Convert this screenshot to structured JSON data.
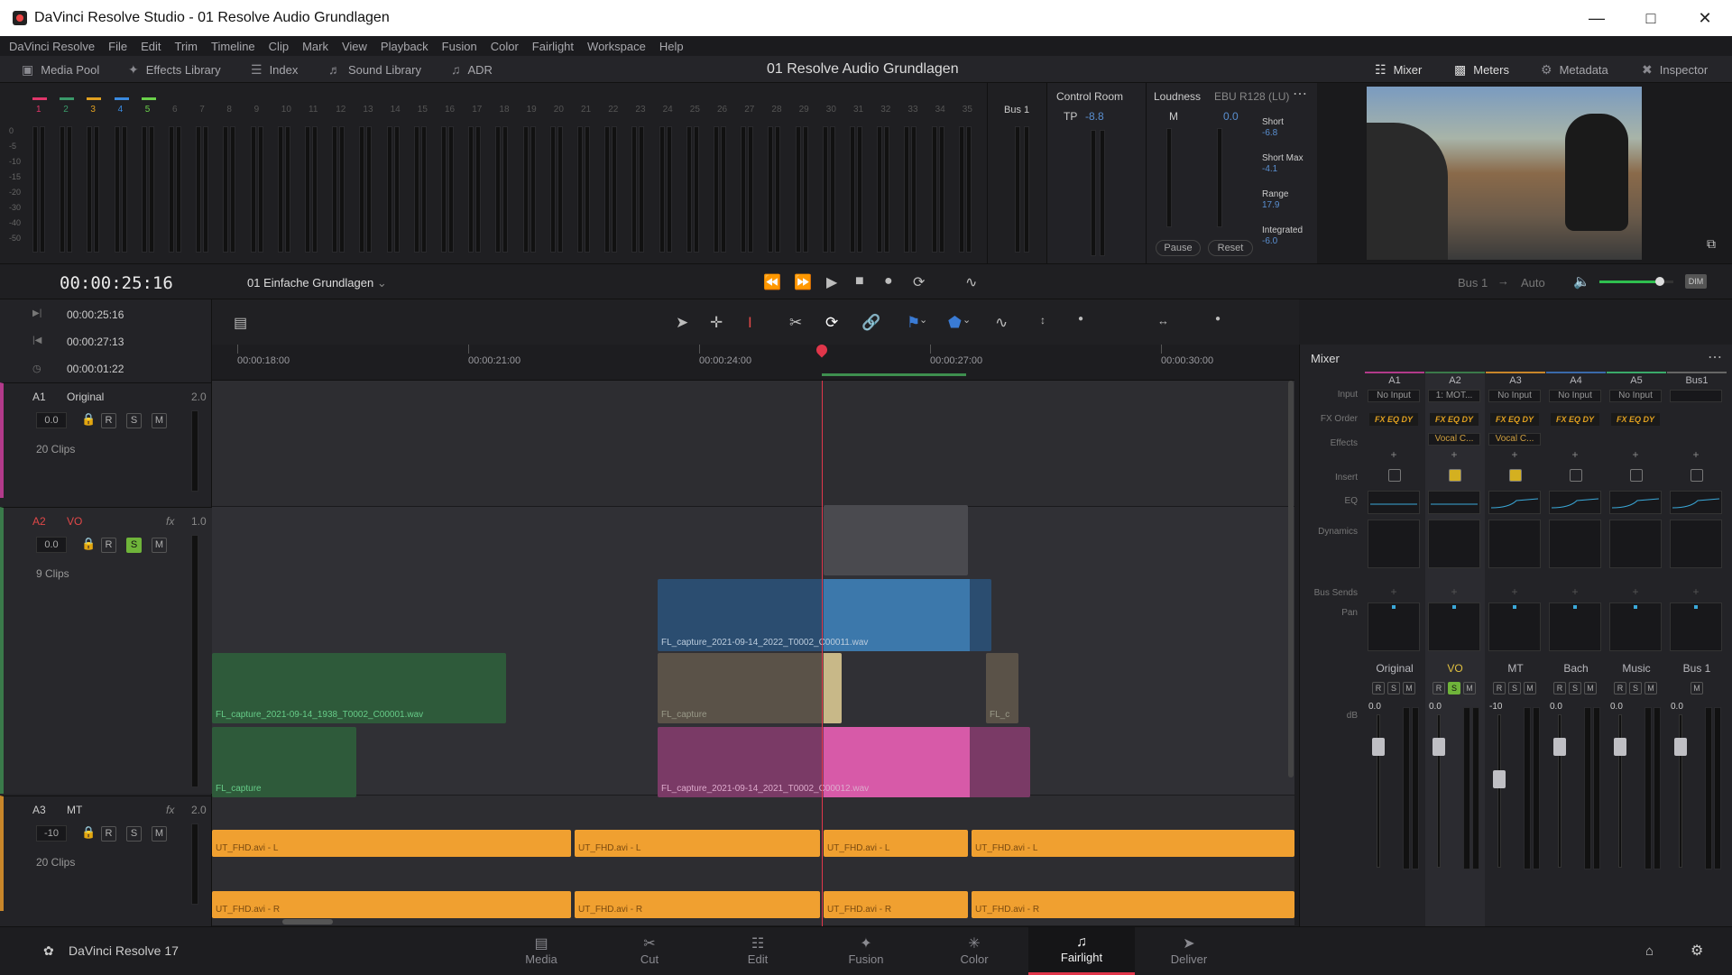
{
  "window": {
    "title": "DaVinci Resolve Studio - 01 Resolve Audio Grundlagen"
  },
  "menu": [
    "DaVinci Resolve",
    "File",
    "Edit",
    "Trim",
    "Timeline",
    "Clip",
    "Mark",
    "View",
    "Playback",
    "Fusion",
    "Color",
    "Fairlight",
    "Workspace",
    "Help"
  ],
  "toolbar": {
    "media_pool": "Media Pool",
    "effects_library": "Effects Library",
    "index": "Index",
    "sound_library": "Sound Library",
    "adr": "ADR",
    "project_title": "01 Resolve Audio Grundlagen",
    "mixer": "Mixer",
    "meters": "Meters",
    "metadata": "Metadata",
    "inspector": "Inspector"
  },
  "meters": {
    "channels": [
      "1",
      "2",
      "3",
      "4",
      "5",
      "6",
      "7",
      "8",
      "9",
      "10",
      "11",
      "12",
      "13",
      "14",
      "15",
      "16",
      "17",
      "18",
      "19",
      "20",
      "21",
      "22",
      "23",
      "24",
      "25",
      "26",
      "27",
      "28",
      "29",
      "30",
      "31",
      "32",
      "33",
      "34",
      "35"
    ],
    "scale": [
      "0",
      "-5",
      "-10",
      "-15",
      "-20",
      "-30",
      "-40",
      "-50"
    ],
    "bus_label": "Bus 1"
  },
  "control_room": {
    "title": "Control Room",
    "tp_label": "TP",
    "tp_value": "-8.8"
  },
  "loudness": {
    "title": "Loudness",
    "standard": "EBU R128 (LU)",
    "m_label": "M",
    "m_value": "0.0",
    "short_label": "Short",
    "short_value": "-6.8",
    "short_max_label": "Short Max",
    "short_max_value": "-4.1",
    "range_label": "Range",
    "range_value": "17.9",
    "integrated_label": "Integrated",
    "integrated_value": "-6.0",
    "pause": "Pause",
    "reset": "Reset"
  },
  "transport": {
    "timecode": "00:00:25:16",
    "timeline_name": "01 Einfache Grundlagen",
    "bus": "Bus 1",
    "auto": "Auto",
    "dim": "DIM",
    "master_volume": 0.82
  },
  "timecodes": {
    "current": "00:00:25:16",
    "out": "00:00:27:13",
    "duration": "00:00:01:22"
  },
  "ruler": [
    "00:00:18:00",
    "00:00:21:00",
    "00:00:24:00",
    "00:00:27:00",
    "00:00:30:00"
  ],
  "tracks": [
    {
      "id": "A1",
      "name": "Original",
      "format": "2.0",
      "volume": "0.0",
      "clips": "20 Clips",
      "fx": ""
    },
    {
      "id": "A2",
      "name": "VO",
      "format": "1.0",
      "volume": "0.0",
      "clips": "9 Clips",
      "fx": "fx"
    },
    {
      "id": "A3",
      "name": "MT",
      "format": "2.0",
      "volume": "-10",
      "clips": "20 Clips",
      "fx": "fx"
    }
  ],
  "clip_labels": {
    "vo_blue": "FL_capture_2021-09-14_2022_T0002_C00011.wav",
    "vo_green": "FL_capture_2021-09-14_1938_T0002_C00001.wav",
    "vo_tan": "FL_capture",
    "vo_tan2": "FL_c",
    "vo_green2": "FL_capture",
    "vo_pink": "FL_capture_2021-09-14_2021_T0002_C00012.wav",
    "mt_l": "UT_FHD.avi - L",
    "mt_r": "UT_FHD.avi - R"
  },
  "mixer": {
    "title": "Mixer",
    "row_labels": {
      "input": "Input",
      "fx_order": "FX Order",
      "effects": "Effects",
      "insert": "Insert",
      "eq": "EQ",
      "dynamics": "Dynamics",
      "bus_sends": "Bus Sends",
      "pan": "Pan",
      "db": "dB"
    },
    "fx_order": "FX EQ DY",
    "channels": [
      {
        "id": "A1",
        "input": "No Input",
        "effect": "",
        "name": "Original",
        "level": "0.0"
      },
      {
        "id": "A2",
        "input": "1: MOT...",
        "effect": "Vocal C...",
        "name": "VO",
        "level": "0.0"
      },
      {
        "id": "A3",
        "input": "No Input",
        "effect": "Vocal C...",
        "name": "MT",
        "level": "-10"
      },
      {
        "id": "A4",
        "input": "No Input",
        "effect": "",
        "name": "Bach",
        "level": "0.0"
      },
      {
        "id": "A5",
        "input": "No Input",
        "effect": "",
        "name": "Music",
        "level": "0.0"
      },
      {
        "id": "Bus1",
        "input": "",
        "effect": "",
        "name": "Bus 1",
        "level": "0.0"
      }
    ],
    "scale": [
      "0",
      "-5",
      "-10",
      "-15",
      "-20",
      "-30",
      "-40",
      "-50"
    ]
  },
  "pages": [
    "Media",
    "Cut",
    "Edit",
    "Fusion",
    "Color",
    "Fairlight",
    "Deliver"
  ],
  "brand": "DaVinci Resolve 17",
  "colors": {
    "accent": "#e0364a",
    "orange": "#f0a030",
    "blue": "#3a6f9e",
    "pink": "#c8508c",
    "green": "#2e5a3a"
  }
}
